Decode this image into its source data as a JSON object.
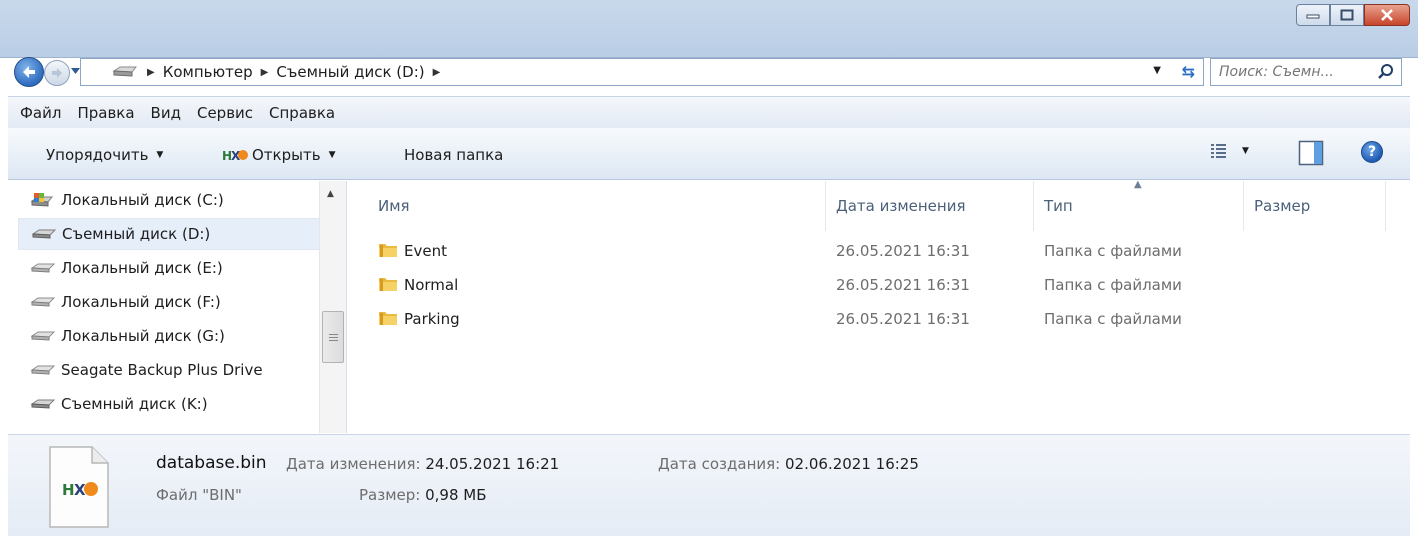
{
  "window": {
    "minimize_icon": "minimize-icon",
    "maximize_icon": "maximize-icon",
    "close_icon": "close-icon"
  },
  "address": {
    "crumbs": [
      "Компьютер",
      "Съемный диск (D:)"
    ],
    "search_placeholder": "Поиск: Съемн..."
  },
  "menu": {
    "items": [
      "Файл",
      "Правка",
      "Вид",
      "Сервис",
      "Справка"
    ]
  },
  "toolbar": {
    "organize": "Упорядочить",
    "open": "Открыть",
    "new_folder": "Новая папка"
  },
  "nav_pane": {
    "items": [
      {
        "label": "Локальный диск (C:)",
        "icon": "system-drive-icon"
      },
      {
        "label": "Съемный диск (D:)",
        "icon": "removable-drive-icon",
        "selected": true
      },
      {
        "label": "Локальный диск (E:)",
        "icon": "drive-icon"
      },
      {
        "label": "Локальный диск (F:)",
        "icon": "drive-icon"
      },
      {
        "label": "Локальный диск (G:)",
        "icon": "drive-icon"
      },
      {
        "label": "Seagate Backup Plus Drive",
        "icon": "drive-icon"
      },
      {
        "label": "Съемный диск (K:)",
        "icon": "removable-drive-icon"
      }
    ]
  },
  "file_list": {
    "columns": [
      "Имя",
      "Дата изменения",
      "Тип",
      "Размер"
    ],
    "rows": [
      {
        "name": "Event",
        "date": "26.05.2021 16:31",
        "type": "Папка с файлами"
      },
      {
        "name": "Normal",
        "date": "26.05.2021 16:31",
        "type": "Папка с файлами"
      },
      {
        "name": "Parking",
        "date": "26.05.2021 16:31",
        "type": "Папка с файлами"
      }
    ]
  },
  "details": {
    "name": "database.bin",
    "modified_label": "Дата изменения:",
    "modified_value": "24.05.2021 16:21",
    "created_label": "Дата создания:",
    "created_value": "02.06.2021 16:25",
    "type": "Файл \"BIN\"",
    "size_label": "Размер:",
    "size_value": "0,98 МБ"
  },
  "colors": {
    "accent": "#2f6cbf",
    "close_red": "#c8452a",
    "selection": "#e5eef9",
    "hxd_orange": "#f08a1c"
  }
}
